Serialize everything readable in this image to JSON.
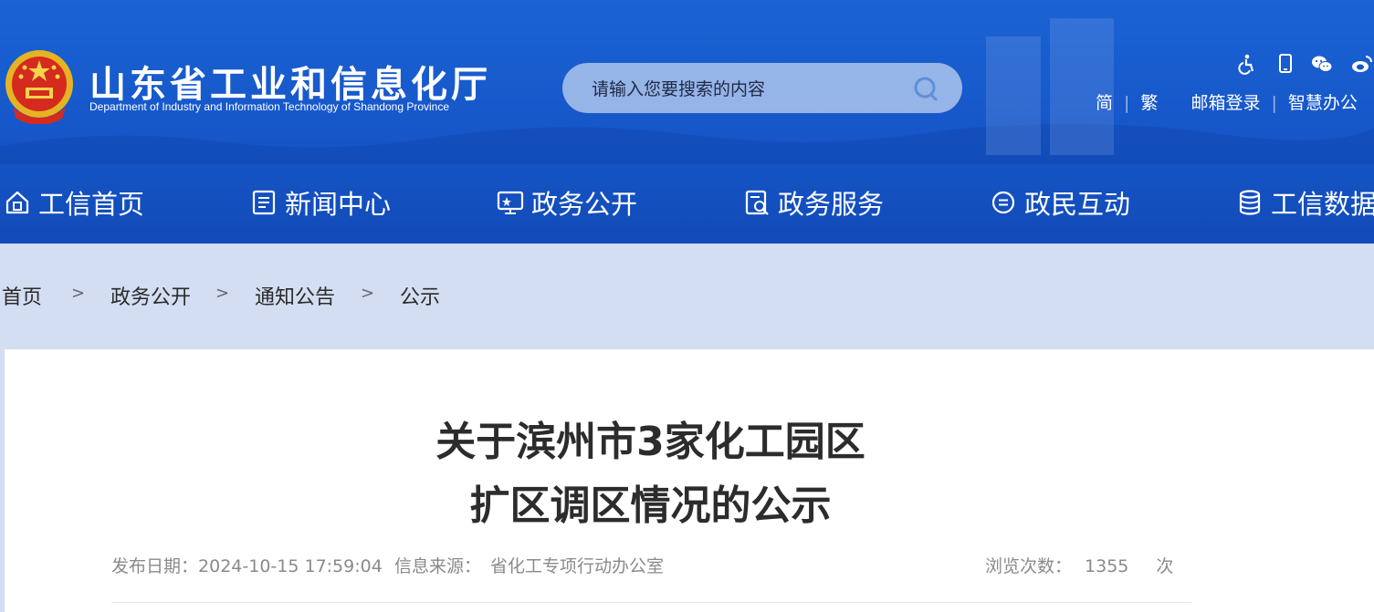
{
  "header": {
    "title_cn": "山东省工业和信息化厅",
    "title_en": "Department of Industry and Information Technology of Shandong Province",
    "search_placeholder": "请输入您要搜索的内容",
    "tools": [
      "accessibility-icon",
      "mobile-icon",
      "wechat-icon",
      "weibo-icon"
    ],
    "links": {
      "simplified": "简",
      "traditional": "繁",
      "mail_login": "邮箱登录",
      "smart_office": "智慧办公",
      "separator": "|"
    }
  },
  "nav": {
    "items": [
      {
        "label": "工信首页",
        "icon": "home-icon"
      },
      {
        "label": "新闻中心",
        "icon": "news-icon"
      },
      {
        "label": "政务公开",
        "icon": "monitor-icon"
      },
      {
        "label": "政务服务",
        "icon": "service-icon"
      },
      {
        "label": "政民互动",
        "icon": "chat-icon"
      },
      {
        "label": "工信数据",
        "icon": "database-icon"
      }
    ]
  },
  "breadcrumb": {
    "items": [
      "首页",
      "政务公开",
      "通知公告",
      "公示"
    ],
    "separator": ">"
  },
  "article": {
    "title_line1": "关于滨州市3家化工园区",
    "title_line2": "扩区调区情况的公示",
    "publish_label": "发布日期：",
    "publish_date": "2024-10-15 17:59:04",
    "source_label": "信息来源：",
    "source": "省化工专项行动办公室",
    "views_label": "浏览次数：",
    "views": "1355",
    "views_unit": "次"
  },
  "colors": {
    "header_blue": "#1656c9",
    "breadcrumb_bg": "#d4def2",
    "title_text": "#2c2c2c",
    "meta_text": "#8a8a8a"
  }
}
